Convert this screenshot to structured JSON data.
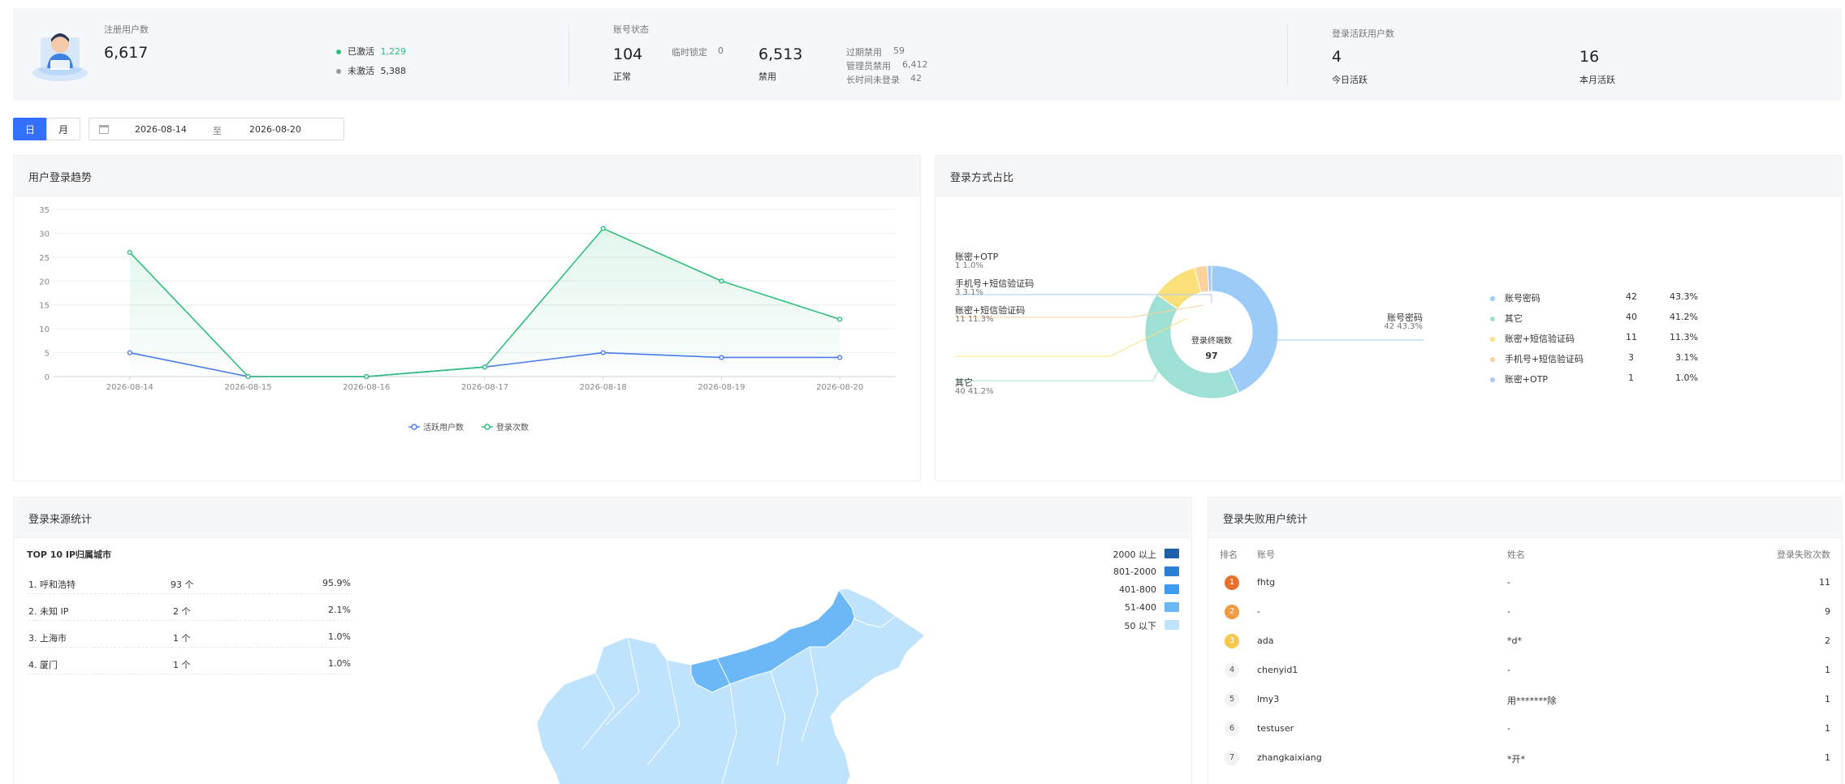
{
  "summary": {
    "registered": {
      "label": "注册用户数",
      "value": "6,617"
    },
    "activated": {
      "label": "已激活",
      "value": "1,229"
    },
    "inactive": {
      "label": "未激活",
      "value": "5,388"
    },
    "account_status": {
      "label": "账号状态",
      "normal_value": "104",
      "normal_label": "正常",
      "temp_lock_label": "临时锁定",
      "temp_lock_value": "0",
      "disabled_value": "6,513",
      "disabled_label": "禁用",
      "expired_label": "过期禁用",
      "expired_value": "59",
      "admin_label": "管理员禁用",
      "admin_value": "6,412",
      "longtime_label": "长时间未登录",
      "longtime_value": "42"
    },
    "active_users": {
      "label": "登录活跃用户数",
      "today_value": "4",
      "today_label": "今日活跃",
      "month_value": "16",
      "month_label": "本月活跃"
    }
  },
  "filter": {
    "day_tab": "日",
    "month_tab": "月",
    "start_date": "2026-08-14",
    "to": "至",
    "end_date": "2026-08-20"
  },
  "trend": {
    "title": "用户登录趋势"
  },
  "login_methods": {
    "title": "登录方式占比",
    "center_label": "登录终端数",
    "center_value": "97",
    "callouts": [
      {
        "name": "账密+OTP",
        "sub": "1   1.0%"
      },
      {
        "name": "手机号+短信验证码",
        "sub": "3   3.1%"
      },
      {
        "name": "账密+短信验证码",
        "sub": "11   11.3%"
      },
      {
        "name": "其它",
        "sub": "40   41.2%"
      },
      {
        "name": "账号密码",
        "sub": "42   43.3%"
      }
    ],
    "legend": [
      {
        "name": "账号密码",
        "count": "42",
        "pct": "43.3%",
        "color": "#9ccbf7"
      },
      {
        "name": "其它",
        "count": "40",
        "pct": "41.2%",
        "color": "#9fe0d6"
      },
      {
        "name": "账密+短信验证码",
        "count": "11",
        "pct": "11.3%",
        "color": "#fbe07a"
      },
      {
        "name": "手机号+短信验证码",
        "count": "3",
        "pct": "3.1%",
        "color": "#fcd29a"
      },
      {
        "name": "账密+OTP",
        "count": "1",
        "pct": "1.0%",
        "color": "#a9c9f5"
      }
    ]
  },
  "source": {
    "title": "登录来源统计",
    "top_title": "TOP 10 IP归属城市",
    "rows": [
      {
        "name": "1. 呼和浩特",
        "count": "93 个",
        "pct": "95.9%"
      },
      {
        "name": "2. 未知 IP",
        "count": "2 个",
        "pct": "2.1%"
      },
      {
        "name": "3. 上海市",
        "count": "1 个",
        "pct": "1.0%"
      },
      {
        "name": "4. 厦门",
        "count": "1 个",
        "pct": "1.0%"
      }
    ],
    "map_legend": [
      {
        "label": "2000 以上",
        "color": "#1f5fa8"
      },
      {
        "label": "801-2000",
        "color": "#2b7fd8"
      },
      {
        "label": "401-800",
        "color": "#3d9cf0"
      },
      {
        "label": "51-400",
        "color": "#6cb8f7"
      },
      {
        "label": "50 以下",
        "color": "#bfe3fc"
      }
    ]
  },
  "failed": {
    "title": "登录失败用户统计",
    "headers": {
      "rank": "排名",
      "account": "账号",
      "name": "姓名",
      "count": "登录失败次数"
    },
    "rows": [
      {
        "rank": "1",
        "account": "fhtg",
        "name": "-",
        "count": "11"
      },
      {
        "rank": "2",
        "account": "-",
        "name": "-",
        "count": "9"
      },
      {
        "rank": "3",
        "account": "ada",
        "name": "*d*",
        "count": "2"
      },
      {
        "rank": "4",
        "account": "chenyid1",
        "name": "-",
        "count": "1"
      },
      {
        "rank": "5",
        "account": "lmy3",
        "name": "用*******除",
        "count": "1"
      },
      {
        "rank": "6",
        "account": "testuser",
        "name": "-",
        "count": "1"
      },
      {
        "rank": "7",
        "account": "zhangkaixiang",
        "name": "*开*",
        "count": "1"
      }
    ]
  },
  "chart_data": {
    "type": "line",
    "x": [
      "2026-08-14",
      "2026-08-15",
      "2026-08-16",
      "2026-08-17",
      "2026-08-18",
      "2026-08-19",
      "2026-08-20"
    ],
    "yticks": [
      "0",
      "5",
      "10",
      "15",
      "20",
      "25",
      "30",
      "35"
    ],
    "ylim": [
      0,
      35
    ],
    "grid": true,
    "legend_position": "bottom",
    "series": [
      {
        "name": "活跃用户数",
        "values": [
          5,
          0,
          0,
          2,
          5,
          4,
          4
        ],
        "color": "#4a7cf0"
      },
      {
        "name": "登录次数",
        "values": [
          26,
          0,
          0,
          2,
          31,
          20,
          12
        ],
        "color": "#2fbf7a"
      }
    ]
  }
}
